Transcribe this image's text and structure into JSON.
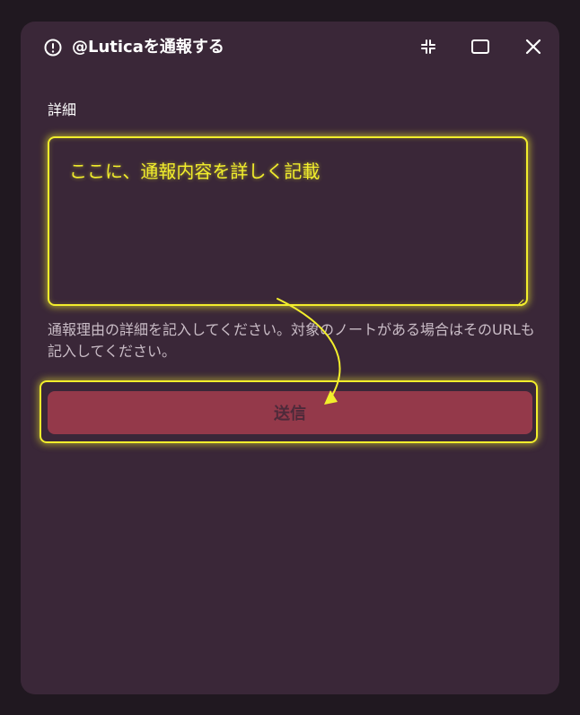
{
  "dialog": {
    "title": "@Luticaを通報する",
    "header_icon": "exclamation-circle-icon",
    "shrink_icon": "shrink-icon",
    "maximize_icon": "maximize-icon",
    "close_icon": "close-icon"
  },
  "form": {
    "detail_label": "詳細",
    "detail_value": "ここに、通報内容を詳しく記載",
    "caption": "通報理由の詳細を記入してください。対象のノートがある場合はそのURLも記入してください。",
    "submit_label": "送信"
  },
  "colors": {
    "background": "#201820",
    "dialog": "#3a2738",
    "highlight": "#f2ee2c",
    "submit": "#94394a"
  }
}
